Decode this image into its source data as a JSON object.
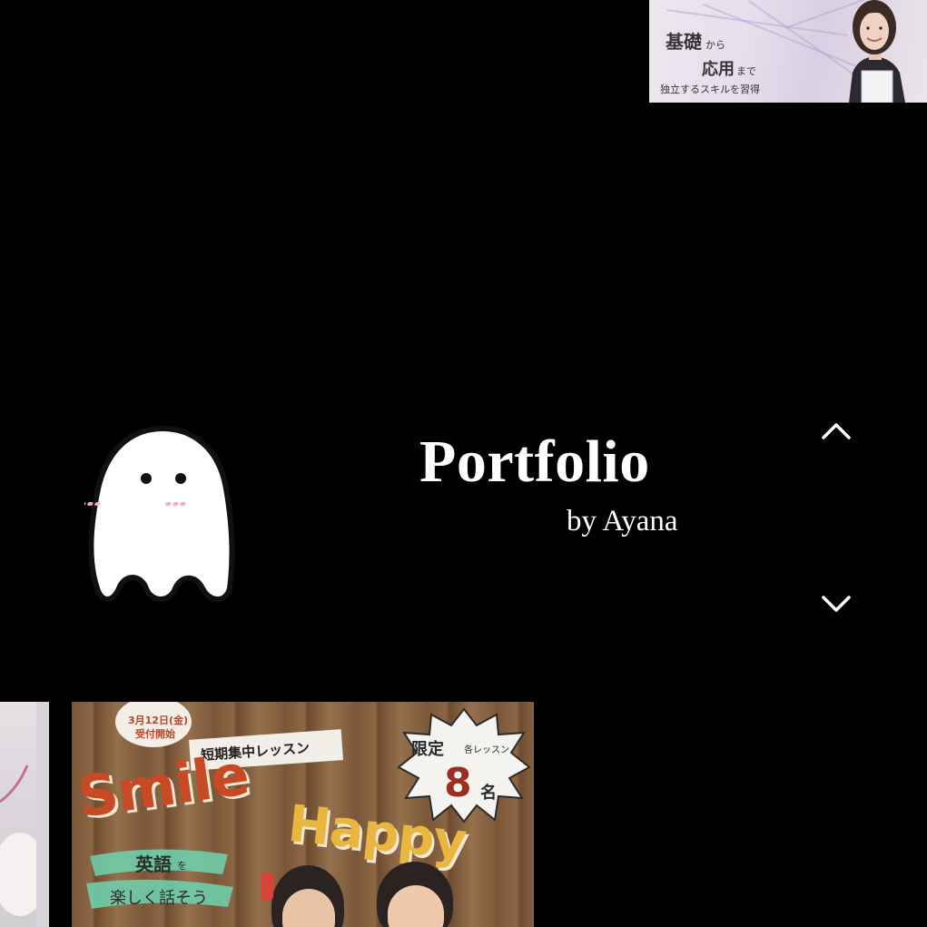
{
  "header": {
    "title": "Portfolio",
    "subtitle": "by Ayana"
  },
  "navigation": {
    "up_icon": "chevron-up-icon",
    "down_icon": "chevron-down-icon"
  },
  "mascot": {
    "icon": "ghost-icon"
  },
  "thumbnails": {
    "top_right": {
      "line1": "基礎",
      "line1_small": "から",
      "line2": "応用",
      "line2_small": "まで",
      "line3": "独立するスキルを習得"
    },
    "bottom_main": {
      "date_line1": "3月12日(金)",
      "date_line2": "受付開始",
      "banner": "短期集中レッスン",
      "limit_label": "限定",
      "limit_sub": "各レッスン",
      "limit_count": "8",
      "limit_unit": "名",
      "word1": "Smile",
      "word2": "Happy",
      "english_label": "英語",
      "english_sub": "を",
      "tagline": "楽しく話そう"
    }
  },
  "colors": {
    "background": "#000000",
    "text": "#ffffff",
    "smile": "#c74a24",
    "happy": "#e9b640"
  }
}
